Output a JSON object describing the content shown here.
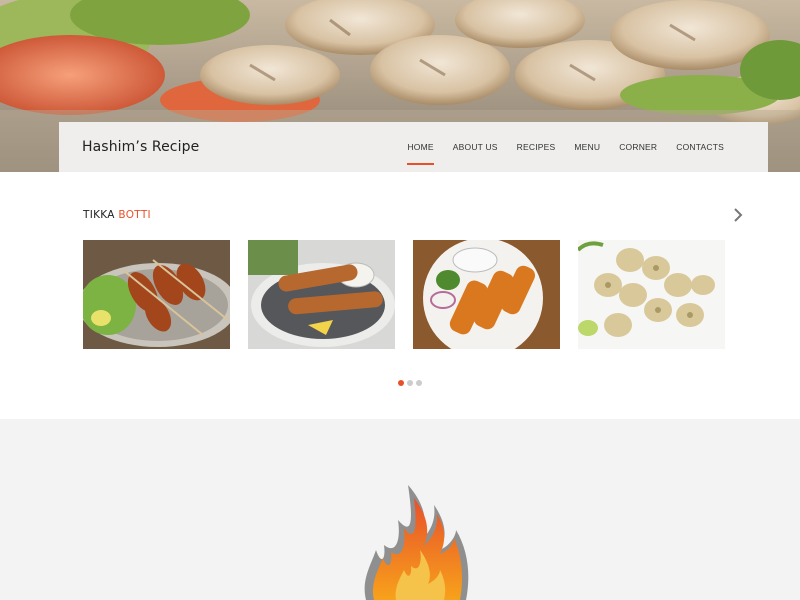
{
  "brand": "Hashim’s Recipe",
  "nav": {
    "items": [
      {
        "label": "HOME",
        "active": true
      },
      {
        "label": "ABOUT US",
        "active": false
      },
      {
        "label": "RECIPES",
        "active": false
      },
      {
        "label": "MENU",
        "active": false
      },
      {
        "label": "CORNER",
        "active": false
      },
      {
        "label": "CONTACTS",
        "active": false
      }
    ]
  },
  "section": {
    "title_part1": "TIKKA ",
    "title_part2": "BOTTI"
  },
  "carousel": {
    "images": [
      "tikka-plate-salad",
      "tikka-skewers-dip",
      "tikka-plate-raita",
      "chicken-malai-tikka"
    ],
    "active_dot": 0,
    "dot_count": 3
  },
  "colors": {
    "accent": "#e8502b",
    "section_bg": "#ffffff",
    "page_bg": "#f3f3f3"
  },
  "icons": {
    "next": "chevron-right-icon",
    "logo": "flame-icon"
  }
}
